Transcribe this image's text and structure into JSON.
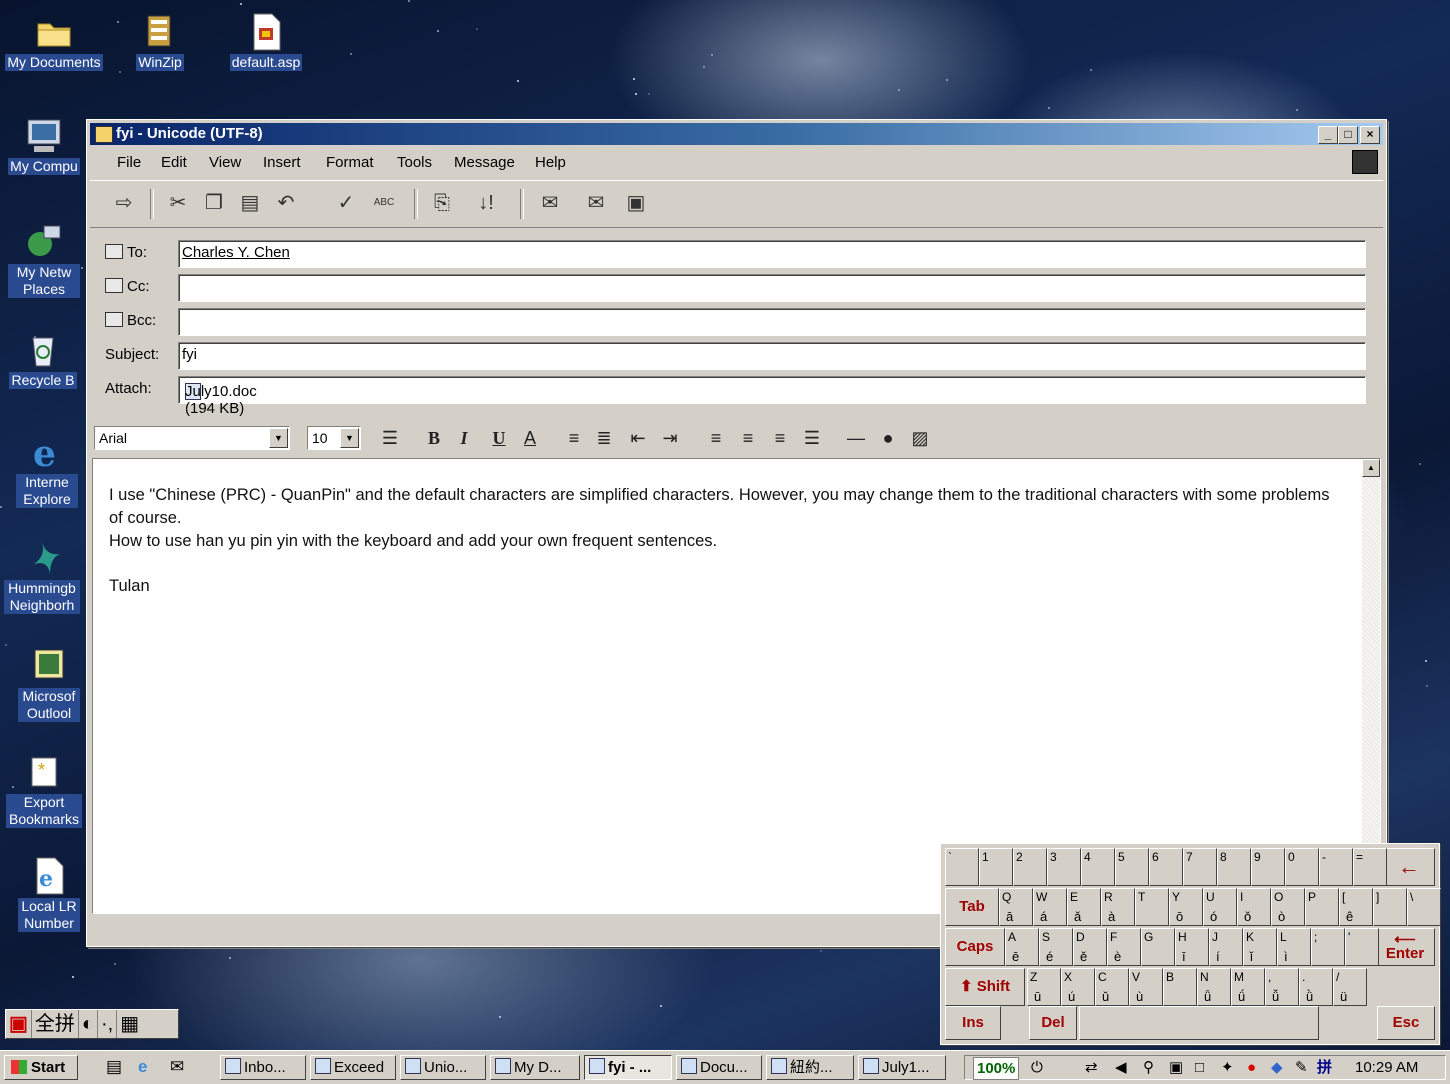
{
  "desktop": {
    "icons": [
      {
        "label": "My Documents",
        "icon": "folder-icon"
      },
      {
        "label": "WinZip",
        "icon": "winzip-icon"
      },
      {
        "label": "default.asp",
        "icon": "asp-file-icon"
      },
      {
        "label": "My Compu",
        "icon": "computer-icon"
      },
      {
        "label": "My Netw Places",
        "icon": "network-icon"
      },
      {
        "label": "Recycle B",
        "icon": "recycle-bin-icon"
      },
      {
        "label": "Interne Explore",
        "icon": "internet-explorer-icon"
      },
      {
        "label": "Hummingb Neighborh",
        "icon": "hummingbird-icon"
      },
      {
        "label": "Microsof Outlool",
        "icon": "outlook-icon"
      },
      {
        "label": "Export Bookmarks",
        "icon": "shortcut-icon"
      },
      {
        "label": "Local LR Number",
        "icon": "html-file-icon"
      }
    ]
  },
  "window": {
    "title": "fyi - Unicode (UTF-8)",
    "controls": {
      "minimize": "_",
      "maximize": "□",
      "close": "×"
    },
    "menu": [
      "File",
      "Edit",
      "View",
      "Insert",
      "Format",
      "Tools",
      "Message",
      "Help"
    ],
    "toolbar": {
      "icons": [
        "send-icon",
        "cut-icon",
        "copy-icon",
        "paste-icon",
        "undo-icon",
        "check-names-icon",
        "spelling-icon",
        "attach-icon",
        "priority-icon",
        "sign-icon",
        "encrypt-icon",
        "offline-icon"
      ],
      "spelling_glyph": "ABC"
    },
    "headers": {
      "to_label": "To:",
      "to_value": "Charles Y. Chen",
      "cc_label": "Cc:",
      "cc_value": "",
      "bcc_label": "Bcc:",
      "bcc_value": "",
      "subject_label": "Subject:",
      "subject_value": "fyi",
      "attach_label": "Attach:",
      "attach_value": "July10.doc (194 KB)"
    },
    "format": {
      "font": "Arial",
      "size": "10",
      "bold": "B",
      "italic": "I",
      "underline": "U",
      "font_color": "A"
    },
    "body": {
      "line1": "I use \"Chinese (PRC) - QuanPin\" and the default characters are simplified characters. However, you may change them to the traditional characters with some problems of course.",
      "line2": "How to use han yu pin yin with the keyboard and add your own frequent sentences.",
      "signature": "Tulan"
    }
  },
  "keyboard": {
    "row1": [
      "`",
      "1",
      "2",
      "3",
      "4",
      "5",
      "6",
      "7",
      "8",
      "9",
      "0",
      "-",
      "="
    ],
    "backspace": "←",
    "row2": [
      {
        "k": "Q",
        "p": "ā"
      },
      {
        "k": "W",
        "p": "á"
      },
      {
        "k": "E",
        "p": "ǎ"
      },
      {
        "k": "R",
        "p": "à"
      },
      {
        "k": "T",
        "p": ""
      },
      {
        "k": "Y",
        "p": "ō"
      },
      {
        "k": "U",
        "p": "ó"
      },
      {
        "k": "I",
        "p": "ǒ"
      },
      {
        "k": "O",
        "p": "ò"
      },
      {
        "k": "P",
        "p": ""
      },
      {
        "k": "[",
        "p": "ê"
      },
      {
        "k": "]",
        "p": ""
      },
      {
        "k": "\\",
        "p": ""
      }
    ],
    "row3": [
      {
        "k": "A",
        "p": "ē"
      },
      {
        "k": "S",
        "p": "é"
      },
      {
        "k": "D",
        "p": "ě"
      },
      {
        "k": "F",
        "p": "è"
      },
      {
        "k": "G",
        "p": ""
      },
      {
        "k": "H",
        "p": "ī"
      },
      {
        "k": "J",
        "p": "í"
      },
      {
        "k": "K",
        "p": "ǐ"
      },
      {
        "k": "L",
        "p": "ì"
      },
      {
        "k": ";",
        "p": ""
      },
      {
        "k": "'",
        "p": ""
      }
    ],
    "row4": [
      {
        "k": "Z",
        "p": "ū"
      },
      {
        "k": "X",
        "p": "ú"
      },
      {
        "k": "C",
        "p": "ǔ"
      },
      {
        "k": "V",
        "p": "ù"
      },
      {
        "k": "B",
        "p": ""
      },
      {
        "k": "N",
        "p": "ǖ"
      },
      {
        "k": "M",
        "p": "ǘ"
      },
      {
        "k": ",",
        "p": "ǚ"
      },
      {
        "k": ".",
        "p": "ǜ"
      },
      {
        "k": "/",
        "p": "ü"
      }
    ],
    "tab": "Tab",
    "caps": "Caps",
    "enter": "Enter",
    "shift": "Shift",
    "ins": "Ins",
    "del": "Del",
    "esc": "Esc"
  },
  "ime": {
    "mode_icon": "ime-logo-icon",
    "mode": "全拼",
    "moon": "◐",
    "punct": "·,",
    "softkbd": "▦"
  },
  "taskbar": {
    "start": "Start",
    "tasks": [
      {
        "label": "Inbo...",
        "icon": "outlook-icon"
      },
      {
        "label": "Exceed",
        "icon": "exceed-icon"
      },
      {
        "label": "Unio...",
        "icon": "ie-icon"
      },
      {
        "label": "My D...",
        "icon": "folder-icon"
      },
      {
        "label": "fyi - ...",
        "icon": "mail-icon",
        "active": true
      },
      {
        "label": "Docu...",
        "icon": "word-icon"
      },
      {
        "label": "紐約...",
        "icon": "ie-icon"
      },
      {
        "label": "July1...",
        "icon": "word-icon"
      }
    ],
    "tray": {
      "zoom": "100%",
      "ime": "拼",
      "clock": "10:29 AM"
    }
  }
}
